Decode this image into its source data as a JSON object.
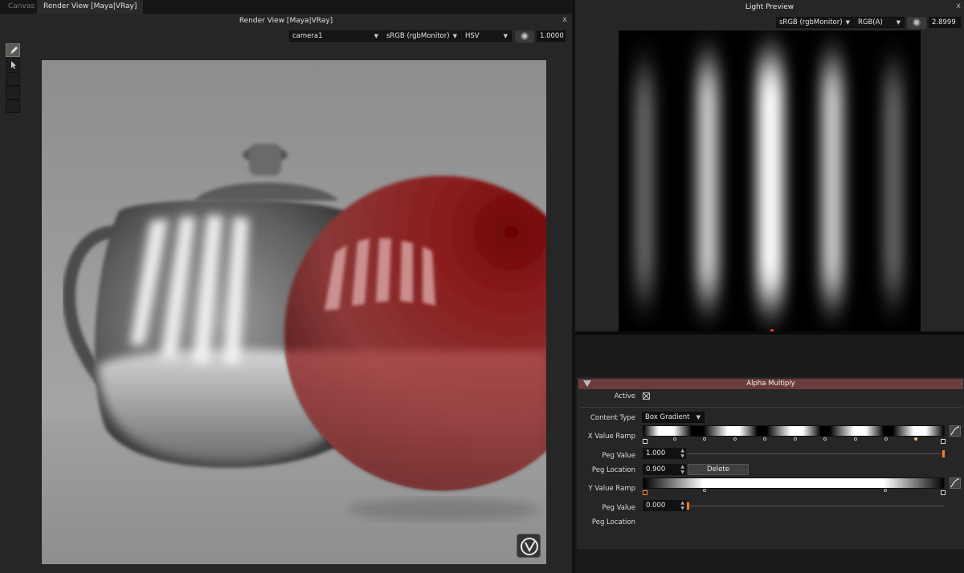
{
  "tabs": [
    {
      "label": "Canvas",
      "active": false
    },
    {
      "label": "Render View [Maya|VRay]",
      "active": true
    }
  ],
  "render_view": {
    "title": "Render View [Maya|VRay]",
    "close": "x",
    "camera": "camera1",
    "color_space": "sRGB (rgbMonitor)",
    "color_mode": "HSV",
    "exposure": "1.0000",
    "tools": [
      "brush-icon",
      "pointer-icon",
      "empty-tool",
      "empty-tool",
      "empty-tool"
    ]
  },
  "light_preview": {
    "title": "Light Preview",
    "close": "x",
    "color_space": "sRGB (rgbMonitor)",
    "channels": "RGB(A)",
    "exposure": "2.8999",
    "stripes": 5
  },
  "properties": {
    "header": "Alpha Multiply",
    "active_label": "Active",
    "active": true,
    "content_type_label": "Content Type",
    "content_type": "Box Gradient",
    "x_ramp_label": "X Value Ramp",
    "x_peg_value_label": "Peg Value",
    "x_peg_value": "1.000",
    "x_peg_location_label": "Peg Location",
    "x_peg_location": "0.900",
    "delete_label": "Delete",
    "y_ramp_label": "Y Value Ramp",
    "y_peg_value_label": "Peg Value",
    "y_peg_value": "0.000",
    "y_peg_location_label": "Peg Location"
  },
  "colors": {
    "header_bar": "#6a3c3c",
    "accent_orange": "#ff7a1a",
    "sphere_red": "#8a1e1e"
  }
}
